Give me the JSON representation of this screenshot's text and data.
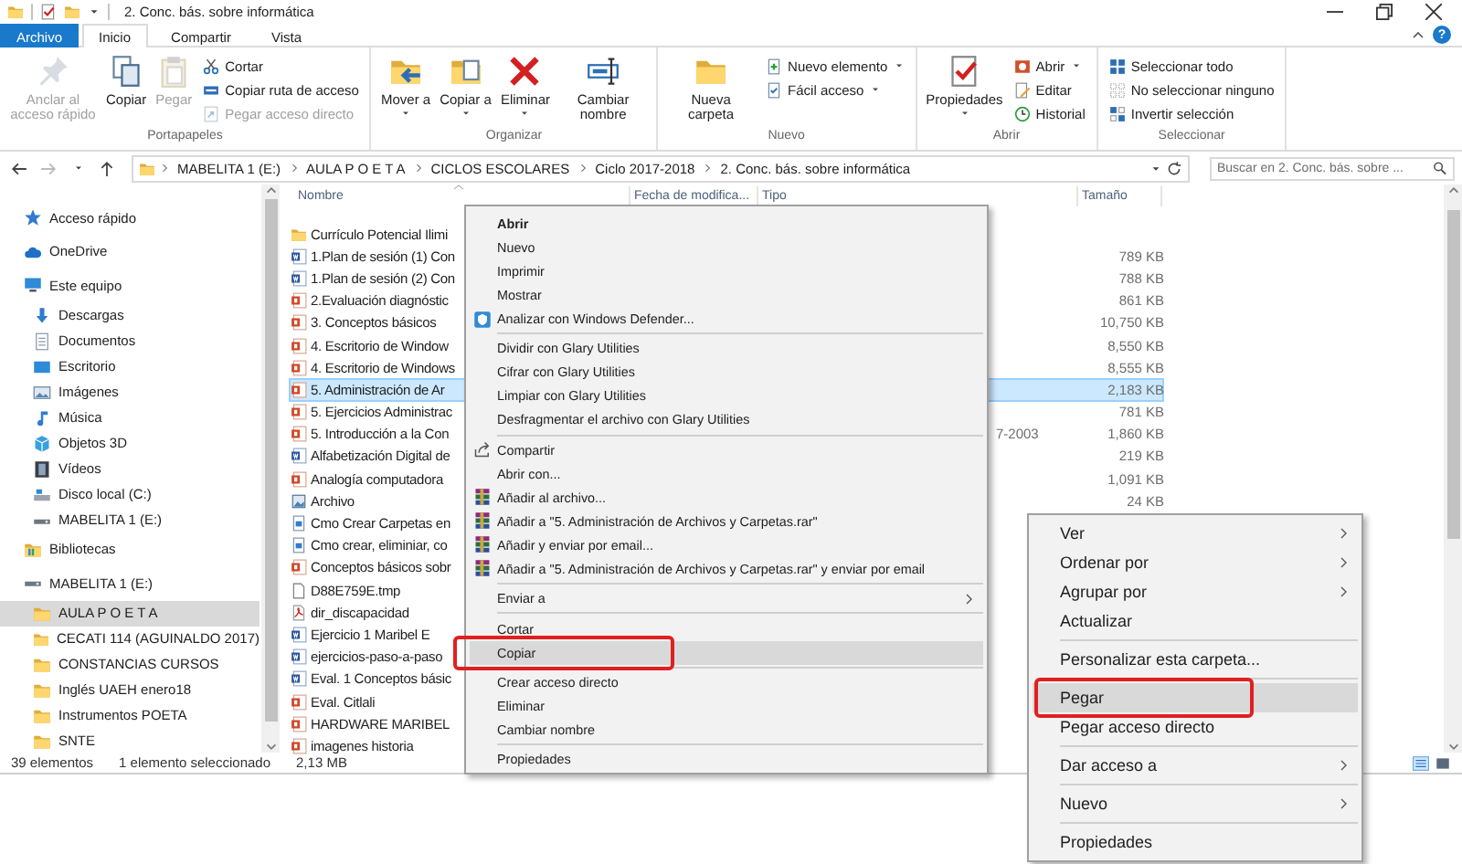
{
  "window": {
    "title": "2. Conc. bás. sobre informática"
  },
  "ribbon": {
    "tabs": [
      {
        "label": "Archivo",
        "kind": "file",
        "selected": false
      },
      {
        "label": "Inicio",
        "kind": "tab",
        "selected": true
      },
      {
        "label": "Compartir",
        "kind": "tab",
        "selected": false
      },
      {
        "label": "Vista",
        "kind": "tab",
        "selected": false
      }
    ],
    "help": "?",
    "groups": [
      {
        "label": "Portapapeles",
        "buttons": [
          {
            "label": "Anclar al acceso rápido",
            "kind": "large",
            "disabled": true,
            "dropdown": false
          },
          {
            "label": "Copiar",
            "kind": "large",
            "disabled": false,
            "dropdown": false
          },
          {
            "label": "Pegar",
            "kind": "large",
            "disabled": true,
            "dropdown": false
          },
          {
            "label": "Cortar",
            "kind": "small",
            "disabled": false,
            "dropdown": false
          },
          {
            "label": "Copiar ruta de acceso",
            "kind": "small",
            "disabled": false,
            "dropdown": false
          },
          {
            "label": "Pegar acceso directo",
            "kind": "small",
            "disabled": true,
            "dropdown": false
          }
        ]
      },
      {
        "label": "Organizar",
        "buttons": [
          {
            "label": "Mover a",
            "kind": "large",
            "disabled": false,
            "dropdown": true
          },
          {
            "label": "Copiar a",
            "kind": "large",
            "disabled": false,
            "dropdown": true
          },
          {
            "label": "Eliminar",
            "kind": "large",
            "disabled": false,
            "dropdown": true
          },
          {
            "label": "Cambiar nombre",
            "kind": "large",
            "disabled": false,
            "dropdown": false
          }
        ]
      },
      {
        "label": "Nuevo",
        "buttons": [
          {
            "label": "Nueva carpeta",
            "kind": "large",
            "disabled": false,
            "dropdown": false
          },
          {
            "label": "Nuevo elemento",
            "kind": "small",
            "disabled": false,
            "dropdown": true
          },
          {
            "label": "Fácil acceso",
            "kind": "small",
            "disabled": false,
            "dropdown": true
          }
        ]
      },
      {
        "label": "Abrir",
        "buttons": [
          {
            "label": "Propiedades",
            "kind": "large",
            "disabled": false,
            "dropdown": true
          },
          {
            "label": "Abrir",
            "kind": "small",
            "disabled": false,
            "dropdown": true
          },
          {
            "label": "Editar",
            "kind": "small",
            "disabled": false,
            "dropdown": false
          },
          {
            "label": "Historial",
            "kind": "small",
            "disabled": false,
            "dropdown": false
          }
        ]
      },
      {
        "label": "Seleccionar",
        "buttons": [
          {
            "label": "Seleccionar todo",
            "kind": "small",
            "disabled": false,
            "dropdown": false
          },
          {
            "label": "No seleccionar ninguno",
            "kind": "small",
            "disabled": false,
            "dropdown": false
          },
          {
            "label": "Invertir selección",
            "kind": "small",
            "disabled": false,
            "dropdown": false
          }
        ]
      }
    ]
  },
  "navigation": [
    {
      "kind": "back",
      "disabled": false
    },
    {
      "kind": "forward",
      "disabled": true
    },
    {
      "kind": "recent",
      "disabled": false
    },
    {
      "kind": "up",
      "disabled": false
    }
  ],
  "address": {
    "crumbs": [
      "MABELITA 1 (E:)",
      "AULA P O E T A",
      "CICLOS ESCOLARES",
      "Ciclo 2017-2018",
      "2. Conc. bás. sobre informática"
    ]
  },
  "search": {
    "placeholder": "Buscar en 2. Conc. bás. sobre ..."
  },
  "sidebar": {
    "items": [
      {
        "label": "Acceso rápido",
        "kind": "quick",
        "selected": false
      },
      {
        "label": "OneDrive",
        "kind": "cloud",
        "selected": false
      },
      {
        "label": "Este equipo",
        "kind": "pc",
        "selected": false,
        "children": [
          {
            "label": "Descargas",
            "kind": "download",
            "selected": false
          },
          {
            "label": "Documentos",
            "kind": "docs",
            "selected": false
          },
          {
            "label": "Escritorio",
            "kind": "desktop",
            "selected": false
          },
          {
            "label": "Imágenes",
            "kind": "pictures",
            "selected": false
          },
          {
            "label": "Música",
            "kind": "music",
            "selected": false
          },
          {
            "label": "Objetos 3D",
            "kind": "objects",
            "selected": false
          },
          {
            "label": "Vídeos",
            "kind": "videos",
            "selected": false
          },
          {
            "label": "Disco local (C:)",
            "kind": "disk",
            "selected": false
          },
          {
            "label": "MABELITA 1 (E:)",
            "kind": "usb",
            "selected": false
          }
        ]
      },
      {
        "label": "Bibliotecas",
        "kind": "library",
        "selected": false
      },
      {
        "label": "MABELITA 1 (E:)",
        "kind": "usb",
        "selected": false,
        "children": [
          {
            "label": "AULA P O E T A",
            "kind": "folder",
            "selected": true
          },
          {
            "label": "CECATI 114 (AGUINALDO 2017)",
            "kind": "folder",
            "selected": false
          },
          {
            "label": "CONSTANCIAS CURSOS",
            "kind": "folder",
            "selected": false
          },
          {
            "label": "Inglés UAEH enero18",
            "kind": "folder",
            "selected": false
          },
          {
            "label": "Instrumentos POETA",
            "kind": "folder",
            "selected": false
          },
          {
            "label": "SNTE",
            "kind": "folder",
            "selected": false
          }
        ]
      }
    ]
  },
  "file_list": {
    "columns": [
      "Nombre",
      "Fecha de modifica...",
      "Tipo",
      "Tamaño"
    ],
    "rows": [
      {
        "name": "Currículo Potencial Ilimi",
        "kind": "folder",
        "selected": false
      },
      {
        "name": "1.Plan de sesión (1) Con",
        "kind": "word",
        "selected": false,
        "size": "789 KB"
      },
      {
        "name": "1.Plan de sesión (2) Con",
        "kind": "word",
        "selected": false,
        "size": "788 KB"
      },
      {
        "name": "2.Evaluación diagnóstic",
        "kind": "powerpoint",
        "selected": false,
        "size": "861 KB"
      },
      {
        "name": "3. Conceptos básicos",
        "kind": "powerpoint",
        "selected": false,
        "size": "10,750 KB"
      },
      {
        "name": "4. Escritorio de Window",
        "kind": "powerpoint",
        "selected": false,
        "size": "8,550 KB"
      },
      {
        "name": "4. Escritorio de Windows",
        "kind": "powerpoint",
        "selected": false,
        "size": "8,555 KB"
      },
      {
        "name": "5. Administración de Ar",
        "kind": "powerpoint",
        "selected": true,
        "size": "2,183 KB"
      },
      {
        "name": "5. Ejercicios Administrac",
        "kind": "powerpoint",
        "selected": false,
        "size": "781 KB"
      },
      {
        "name": "5. Introducción a la Con",
        "kind": "powerpoint",
        "selected": false,
        "type": "7-2003",
        "size": "1,860 KB"
      },
      {
        "name": "Alfabetización Digital de",
        "kind": "word",
        "selected": false,
        "size": "219 KB"
      },
      {
        "name": "Analogía computadora",
        "kind": "powerpoint",
        "selected": false,
        "size": "1,091 KB"
      },
      {
        "name": "Archivo",
        "kind": "image",
        "selected": false,
        "size": "24 KB"
      },
      {
        "name": "Cmo Crear Carpetas en",
        "kind": "document",
        "selected": false
      },
      {
        "name": "Cmo crear, eliminiar, co",
        "kind": "document",
        "selected": false
      },
      {
        "name": "Conceptos básicos sobr",
        "kind": "powerpoint",
        "selected": false
      },
      {
        "name": "D88E759E.tmp",
        "kind": "blank",
        "selected": false
      },
      {
        "name": "dir_discapacidad",
        "kind": "pdf",
        "selected": false
      },
      {
        "name": "Ejercicio 1 Maribel E",
        "kind": "word",
        "selected": false
      },
      {
        "name": "ejercicios-paso-a-paso",
        "kind": "word",
        "selected": false
      },
      {
        "name": "Eval. 1 Conceptos básic",
        "kind": "word",
        "selected": false
      },
      {
        "name": "Eval. Citlali",
        "kind": "powerpoint",
        "selected": false
      },
      {
        "name": "HARDWARE MARIBEL",
        "kind": "powerpoint",
        "selected": false
      },
      {
        "name": "imagenes historia",
        "kind": "powerpoint",
        "selected": false
      }
    ]
  },
  "context_menu": {
    "items": [
      {
        "label": "Abrir",
        "kind": "default",
        "selected": false
      },
      {
        "label": "Nuevo",
        "kind": "item",
        "selected": false
      },
      {
        "label": "Imprimir",
        "kind": "item",
        "selected": false
      },
      {
        "label": "Mostrar",
        "kind": "item",
        "selected": false
      },
      {
        "label": "Analizar con Windows Defender...",
        "kind": "defender",
        "selected": false
      },
      {
        "kind": "separator"
      },
      {
        "label": "Dividir con Glary Utilities",
        "kind": "item",
        "selected": false
      },
      {
        "label": "Cifrar con Glary Utilities",
        "kind": "item",
        "selected": false
      },
      {
        "label": "Limpiar con Glary Utilities",
        "kind": "item",
        "selected": false
      },
      {
        "label": "Desfragmentar el archivo con Glary Utilities",
        "kind": "item",
        "selected": false
      },
      {
        "kind": "separator"
      },
      {
        "label": "Compartir",
        "kind": "share",
        "selected": false
      },
      {
        "label": "Abrir con...",
        "kind": "item",
        "selected": false
      },
      {
        "label": "Añadir al archivo...",
        "kind": "archive",
        "selected": false
      },
      {
        "label": "Añadir a \"5. Administración de Archivos y Carpetas.rar\"",
        "kind": "archive",
        "selected": false
      },
      {
        "label": "Añadir y enviar por email...",
        "kind": "archive",
        "selected": false
      },
      {
        "label": "Añadir a \"5. Administración de Archivos y Carpetas.rar\" y enviar por email",
        "kind": "archive",
        "selected": false
      },
      {
        "kind": "separator"
      },
      {
        "label": "Enviar a",
        "kind": "submenu",
        "selected": false
      },
      {
        "kind": "separator"
      },
      {
        "label": "Cortar",
        "kind": "item",
        "selected": false
      },
      {
        "label": "Copiar",
        "kind": "item",
        "selected": true
      },
      {
        "kind": "separator"
      },
      {
        "label": "Crear acceso directo",
        "kind": "item",
        "selected": false
      },
      {
        "label": "Eliminar",
        "kind": "item",
        "selected": false
      },
      {
        "label": "Cambiar nombre",
        "kind": "item",
        "selected": false
      },
      {
        "kind": "separator"
      },
      {
        "label": "Propiedades",
        "kind": "item",
        "selected": false
      }
    ]
  },
  "background_menu": {
    "items": [
      {
        "label": "Ver",
        "kind": "submenu",
        "selected": false
      },
      {
        "label": "Ordenar por",
        "kind": "submenu",
        "selected": false
      },
      {
        "label": "Agrupar por",
        "kind": "submenu",
        "selected": false
      },
      {
        "label": "Actualizar",
        "kind": "item",
        "selected": false
      },
      {
        "kind": "separator"
      },
      {
        "label": "Personalizar esta carpeta...",
        "kind": "item",
        "selected": false
      },
      {
        "kind": "separator"
      },
      {
        "label": "Pegar",
        "kind": "item",
        "selected": true
      },
      {
        "label": "Pegar acceso directo",
        "kind": "item",
        "selected": false
      },
      {
        "kind": "separator"
      },
      {
        "label": "Dar acceso a",
        "kind": "submenu",
        "selected": false
      },
      {
        "kind": "separator"
      },
      {
        "label": "Nuevo",
        "kind": "submenu",
        "selected": false
      },
      {
        "kind": "separator"
      },
      {
        "label": "Propiedades",
        "kind": "item",
        "selected": false
      }
    ]
  },
  "status_bar": {
    "count": "39 elementos",
    "selection": "1 elemento seleccionado",
    "size": "2,13 MB"
  }
}
